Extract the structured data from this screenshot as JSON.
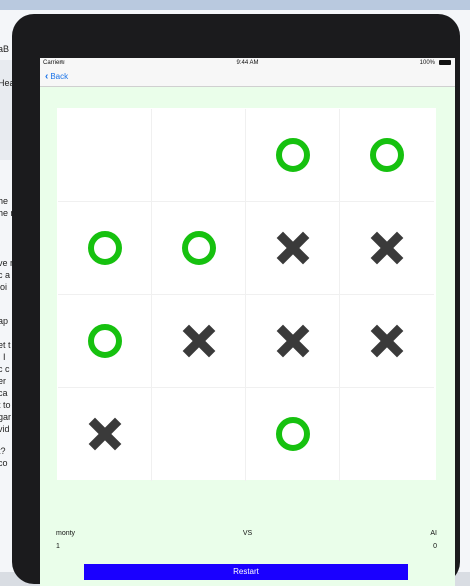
{
  "background_window": {
    "fragments": [
      "aB",
      "Hea",
      "he",
      "he n",
      "ve r",
      "c a",
      "ioi",
      "ap",
      "et t",
      ". I",
      "c c",
      "er",
      "ca",
      "t to",
      "gar",
      "vid",
      "t?",
      "co"
    ]
  },
  "status_bar": {
    "carrier": "Carrier",
    "time": "9:44 AM",
    "battery": "100%"
  },
  "nav": {
    "back_label": "Back"
  },
  "board": {
    "rows": 4,
    "cols": 4,
    "cells": [
      "",
      "",
      "O",
      "O",
      "O",
      "O",
      "X",
      "X",
      "O",
      "X",
      "X",
      "X",
      "X",
      "",
      "O",
      ""
    ]
  },
  "scoreboard": {
    "player_left_name": "monty",
    "player_left_score": "1",
    "vs_label": "VS",
    "player_right_name": "AI",
    "player_right_score": "0"
  },
  "restart_label": "Restart",
  "colors": {
    "o_mark": "#16c10f",
    "x_mark": "#3a3a3a",
    "restart_button": "#1a00ff",
    "screen_background": "#eafeea",
    "link": "#1a73e8"
  }
}
